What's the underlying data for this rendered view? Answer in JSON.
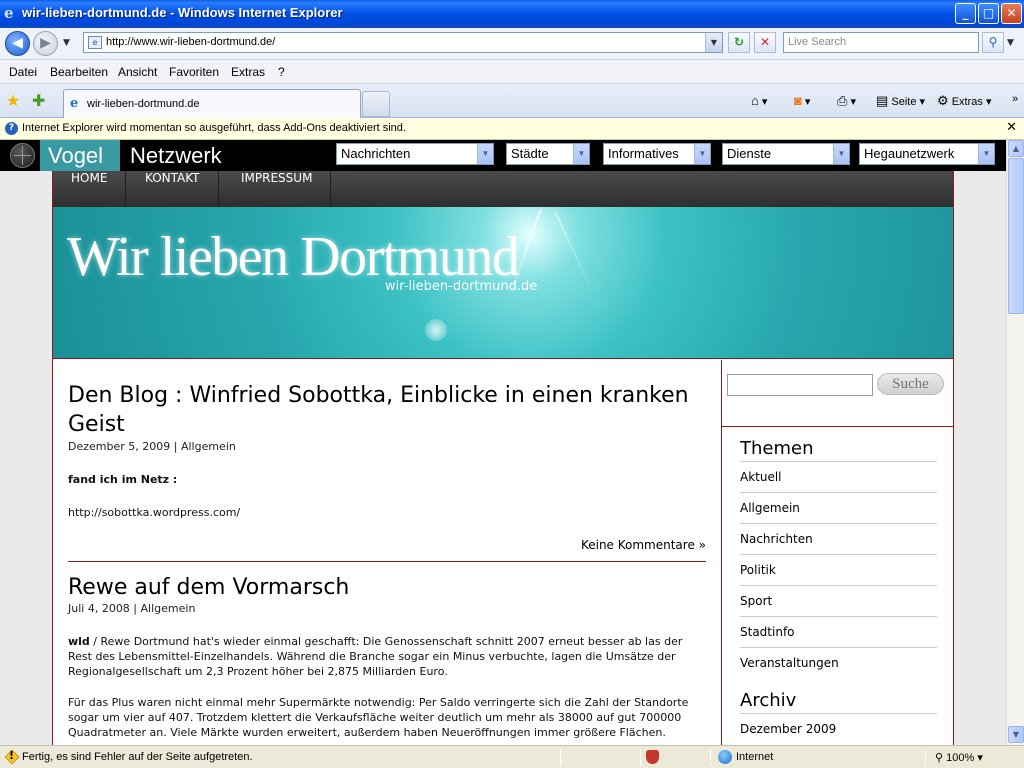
{
  "window": {
    "title": "wir-lieben-dortmund.de - Windows Internet Explorer",
    "minimize": "_",
    "maximize": "□",
    "close": "✕"
  },
  "address_bar": {
    "url": "http://www.wir-lieben-dortmund.de/",
    "search_placeholder": "Live Search"
  },
  "menu": [
    "Datei",
    "Bearbeiten",
    "Ansicht",
    "Favoriten",
    "Extras",
    "?"
  ],
  "tabs": [
    {
      "label": "wir-lieben-dortmund.de"
    }
  ],
  "command_bar": {
    "page_label": "Seite",
    "tools_label": "Extras"
  },
  "info_bar": {
    "text": "Internet Explorer wird momentan so ausgeführt, dass Add-Ons deaktiviert sind.",
    "close": "✕"
  },
  "vogel_bar": {
    "brand1": "Vogel",
    "brand2": "Netzwerk",
    "selects": [
      "Nachrichten",
      "Städte",
      "Informatives",
      "Dienste",
      "Hegaunetzwerk"
    ]
  },
  "site": {
    "nav": [
      "HOME",
      "KONTAKT",
      "IMPRESSUM"
    ],
    "banner_title": "Wir lieben Dortmund",
    "banner_subtitle": "wir-lieben-dortmund.de"
  },
  "posts": [
    {
      "title": "Den Blog : Winfried Sobottka, Einblicke in einen kranken Geist",
      "date": "Dezember 5, 2009",
      "category": "Allgemein",
      "bold_line": "fand ich im Netz :",
      "link": "http://sobottka.wordpress.com/",
      "comments": "Keine Kommentare »"
    },
    {
      "title": "Rewe auf dem Vormarsch",
      "date": "Juli 4, 2008",
      "category": "Allgemein",
      "lead_bold": "wld",
      "para1": " / Rewe Dortmund hat's wieder einmal geschafft: Die Genossenschaft schnitt 2007 erneut besser ab las der Rest des Lebensmittel-Einzelhandels. Während die Branche sogar ein Minus verbuchte, lagen die Umsätze der Regionalgesellschaft um 2,3 Prozent höher bei 2,875 Milliarden Euro.",
      "para2": "Für das Plus waren nicht einmal mehr Supermärkte notwendig: Per Saldo verringerte sich die Zahl der Standorte sogar um vier auf 407. Trotzdem klettert die Verkaufsfläche weiter deutlich um mehr als 38000 auf gut 700000 Quadratmeter an. Viele Märkte wurden erweitert, außerdem haben Neueröffnungen immer größere Flächen."
    }
  ],
  "sidebar": {
    "search_button": "Suche",
    "themen_heading": "Themen",
    "themen": [
      "Aktuell",
      "Allgemein",
      "Nachrichten",
      "Politik",
      "Sport",
      "Stadtinfo",
      "Veranstaltungen"
    ],
    "archiv_heading": "Archiv",
    "archiv": [
      "Dezember 2009"
    ]
  },
  "status_bar": {
    "text": "Fertig, es sind Fehler auf der Seite aufgetreten.",
    "zone": "Internet",
    "zoom": "100%"
  },
  "colors": {
    "accent_red": "#8b1a1a",
    "banner_teal": "#27a7ad",
    "vogel_teal": "#3a9aa3"
  }
}
